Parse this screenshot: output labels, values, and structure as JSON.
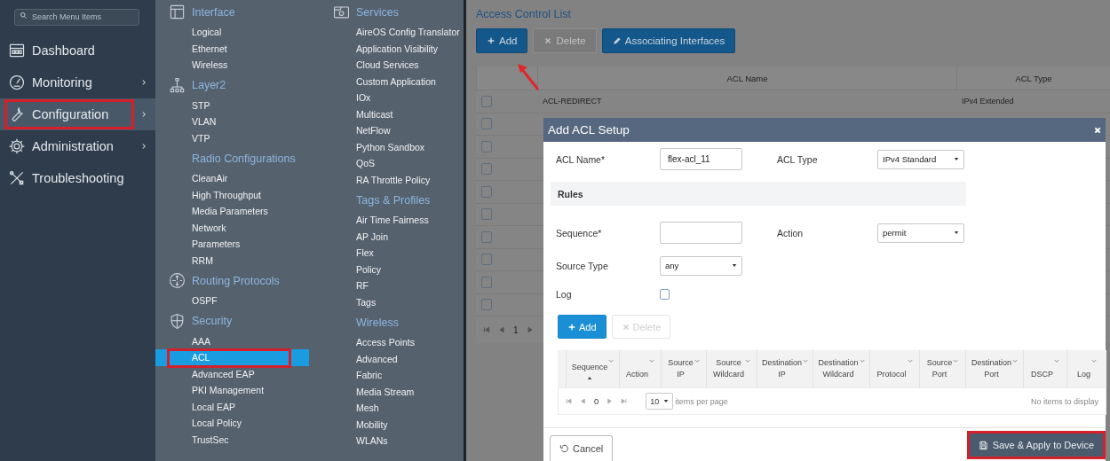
{
  "sidebar": {
    "search": {
      "placeholder": "Search Menu Items"
    },
    "items": [
      {
        "label": "Dashboard",
        "submenu": false,
        "selected": false,
        "highlighted": false
      },
      {
        "label": "Monitoring",
        "submenu": true,
        "selected": false,
        "highlighted": false
      },
      {
        "label": "Configuration",
        "submenu": true,
        "selected": true,
        "highlighted": true
      },
      {
        "label": "Administration",
        "submenu": true,
        "selected": false,
        "highlighted": false
      },
      {
        "label": "Troubleshooting",
        "submenu": false,
        "selected": false,
        "highlighted": false
      }
    ]
  },
  "menu": {
    "columns": [
      [
        {
          "title": "Interface",
          "items": [
            {
              "label": "Logical",
              "selected": false,
              "highlighted": false
            },
            {
              "label": "Ethernet",
              "selected": false,
              "highlighted": false
            },
            {
              "label": "Wireless",
              "selected": false,
              "highlighted": false
            }
          ]
        },
        {
          "title": "Layer2",
          "items": [
            {
              "label": "STP",
              "selected": false,
              "highlighted": false
            },
            {
              "label": "VLAN",
              "selected": false,
              "highlighted": false
            },
            {
              "label": "VTP",
              "selected": false,
              "highlighted": false
            }
          ]
        },
        {
          "title": "Radio Configurations",
          "items": [
            {
              "label": "CleanAir",
              "selected": false,
              "highlighted": false
            },
            {
              "label": "High Throughput",
              "selected": false,
              "highlighted": false
            },
            {
              "label": "Media Parameters",
              "selected": false,
              "highlighted": false
            },
            {
              "label": "Network",
              "selected": false,
              "highlighted": false
            },
            {
              "label": "Parameters",
              "selected": false,
              "highlighted": false
            },
            {
              "label": "RRM",
              "selected": false,
              "highlighted": false
            }
          ]
        },
        {
          "title": "Routing Protocols",
          "items": [
            {
              "label": "OSPF",
              "selected": false,
              "highlighted": false
            }
          ]
        },
        {
          "title": "Security",
          "items": [
            {
              "label": "AAA",
              "selected": false,
              "highlighted": false
            },
            {
              "label": "ACL",
              "selected": true,
              "highlighted": true
            },
            {
              "label": "Advanced EAP",
              "selected": false,
              "highlighted": false
            },
            {
              "label": "PKI Management",
              "selected": false,
              "highlighted": false
            },
            {
              "label": "Local EAP",
              "selected": false,
              "highlighted": false
            },
            {
              "label": "Local Policy",
              "selected": false,
              "highlighted": false
            },
            {
              "label": "TrustSec",
              "selected": false,
              "highlighted": false
            }
          ]
        }
      ],
      [
        {
          "title": "Services",
          "items": [
            {
              "label": "AireOS Config Translator",
              "selected": false,
              "highlighted": false
            },
            {
              "label": "Application Visibility",
              "selected": false,
              "highlighted": false
            },
            {
              "label": "Cloud Services",
              "selected": false,
              "highlighted": false
            },
            {
              "label": "Custom Application",
              "selected": false,
              "highlighted": false
            },
            {
              "label": "IOx",
              "selected": false,
              "highlighted": false
            },
            {
              "label": "Multicast",
              "selected": false,
              "highlighted": false
            },
            {
              "label": "NetFlow",
              "selected": false,
              "highlighted": false
            },
            {
              "label": "Python Sandbox",
              "selected": false,
              "highlighted": false
            },
            {
              "label": "QoS",
              "selected": false,
              "highlighted": false
            },
            {
              "label": "RA Throttle Policy",
              "selected": false,
              "highlighted": false
            }
          ]
        },
        {
          "title": "Tags & Profiles",
          "items": [
            {
              "label": "Air Time Fairness",
              "selected": false,
              "highlighted": false
            },
            {
              "label": "AP Join",
              "selected": false,
              "highlighted": false
            },
            {
              "label": "Flex",
              "selected": false,
              "highlighted": false
            },
            {
              "label": "Policy",
              "selected": false,
              "highlighted": false
            },
            {
              "label": "RF",
              "selected": false,
              "highlighted": false
            },
            {
              "label": "Tags",
              "selected": false,
              "highlighted": false
            }
          ]
        },
        {
          "title": "Wireless",
          "items": [
            {
              "label": "Access Points",
              "selected": false,
              "highlighted": false
            },
            {
              "label": "Advanced",
              "selected": false,
              "highlighted": false
            },
            {
              "label": "Fabric",
              "selected": false,
              "highlighted": false
            },
            {
              "label": "Media Stream",
              "selected": false,
              "highlighted": false
            },
            {
              "label": "Mesh",
              "selected": false,
              "highlighted": false
            },
            {
              "label": "Mobility",
              "selected": false,
              "highlighted": false
            },
            {
              "label": "WLANs",
              "selected": false,
              "highlighted": false
            }
          ]
        }
      ]
    ]
  },
  "page": {
    "title": "Access Control List",
    "toolbar": [
      {
        "label": "Add",
        "kind": "add",
        "disabled": false
      },
      {
        "label": "Delete",
        "kind": "delete",
        "disabled": true
      },
      {
        "label": "Associating Interfaces",
        "kind": "edit",
        "disabled": false
      }
    ],
    "table": {
      "columns": [
        "ACL Name",
        "ACL Type"
      ],
      "rows": [
        {
          "checked": false,
          "acl_name": "ACL-REDIRECT",
          "acl_type": "IPv4 Extended"
        },
        {
          "checked": false
        },
        {
          "checked": false
        },
        {
          "checked": false
        },
        {
          "checked": false
        },
        {
          "checked": false
        },
        {
          "checked": false
        },
        {
          "checked": false
        },
        {
          "checked": false
        },
        {
          "checked": false
        }
      ],
      "pager": {
        "page": "1"
      }
    }
  },
  "modal": {
    "title": "Add ACL Setup",
    "acl_name": {
      "label": "ACL Name*",
      "value": "flex-acl_11"
    },
    "acl_type": {
      "label": "ACL Type",
      "value": "IPv4 Standard"
    },
    "rules_title": "Rules",
    "sequence": {
      "label": "Sequence*"
    },
    "action": {
      "label": "Action",
      "value": "permit"
    },
    "source_type": {
      "label": "Source Type",
      "value": "any"
    },
    "log": {
      "label": "Log",
      "checked": false
    },
    "rule_buttons": [
      {
        "label": "Add",
        "kind": "add",
        "disabled": false
      },
      {
        "label": "Delete",
        "kind": "delete",
        "disabled": true
      }
    ],
    "grid": {
      "columns": [
        {
          "label": "Sequence",
          "sorted": true
        },
        {
          "label": "Action",
          "sorted": false
        },
        {
          "label": "Source IP",
          "sorted": false
        },
        {
          "label": "Source Wildcard",
          "sorted": false
        },
        {
          "label": "Destination IP",
          "sorted": false
        },
        {
          "label": "Destination Wildcard",
          "sorted": false
        },
        {
          "label": "Protocol",
          "sorted": false
        },
        {
          "label": "Source Port",
          "sorted": false
        },
        {
          "label": "Destination Port",
          "sorted": false
        },
        {
          "label": "DSCP",
          "sorted": false
        },
        {
          "label": "Log",
          "sorted": false
        }
      ],
      "pager": {
        "page": "0",
        "page_size": "10",
        "per_page_label": "items per page",
        "empty_text": "No items to display"
      }
    },
    "footer": {
      "cancel": "Cancel",
      "save": {
        "label": "Save & Apply to Device",
        "highlighted": true
      }
    }
  }
}
